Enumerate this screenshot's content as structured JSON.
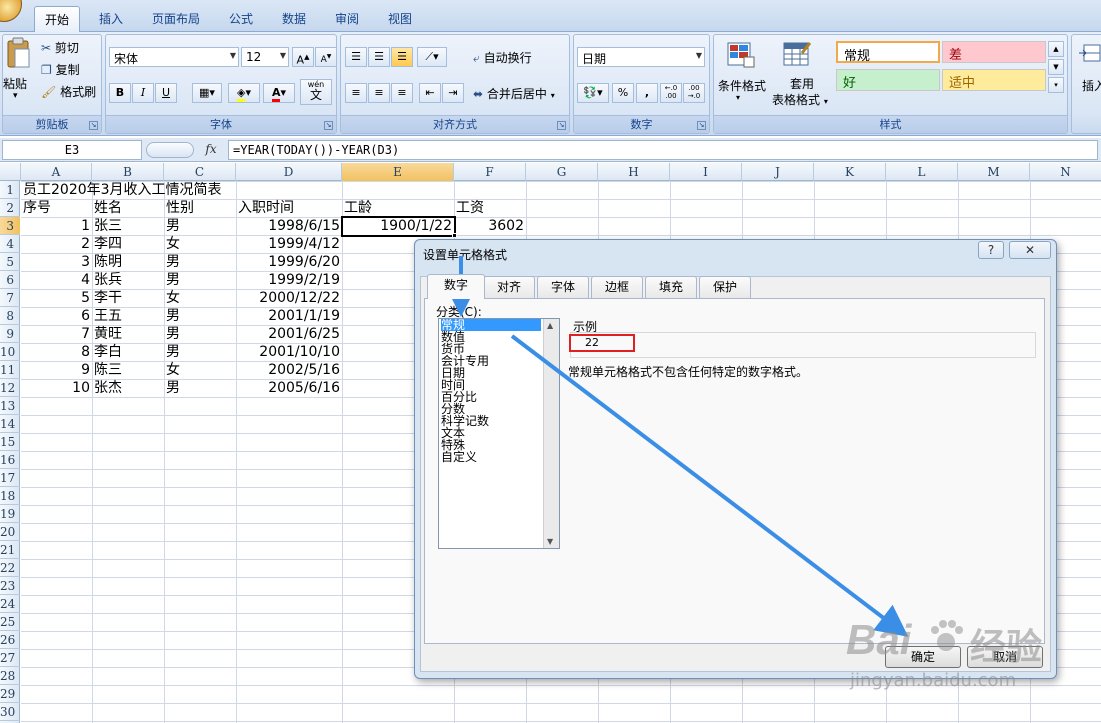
{
  "ribbon": {
    "tabs": [
      "开始",
      "插入",
      "页面布局",
      "公式",
      "数据",
      "审阅",
      "视图"
    ],
    "clipboard": {
      "paste": "粘贴",
      "cut": "剪切",
      "copy": "复制",
      "format_painter": "格式刷",
      "label": "剪贴板"
    },
    "font": {
      "name": "宋体",
      "size": "12",
      "bold": "B",
      "italic": "I",
      "underline": "U",
      "grow": "A",
      "shrink": "A",
      "wen": "wén",
      "wen_char": "文",
      "font_color_letter": "A",
      "label": "字体"
    },
    "alignment": {
      "wrap": "自动换行",
      "merge": "合并后居中",
      "label": "对齐方式"
    },
    "number": {
      "format": "日期",
      "percent": "%",
      "comma": ",",
      "inc_decimal": "←.0 .00",
      "dec_decimal": ".00 →.0",
      "label": "数字"
    },
    "styles": {
      "conditional": "条件格式",
      "table_format_line1": "套用",
      "table_format_line2": "表格格式",
      "normal": "常规",
      "bad": "差",
      "good": "好",
      "neutral": "适中",
      "label": "样式"
    },
    "insert": "插入",
    "colors": {
      "normal_border": "#f2a94a",
      "bad_bg": "#ffc7ce",
      "bad_fg": "#9c0006",
      "good_bg": "#c6efce",
      "good_fg": "#006100",
      "neutral_bg": "#ffeb9c",
      "neutral_fg": "#9c6500"
    }
  },
  "formula_bar": {
    "name_box": "E3",
    "fx": "fx",
    "formula": "=YEAR(TODAY())-YEAR(D3)"
  },
  "grid": {
    "columns": [
      "A",
      "B",
      "C",
      "D",
      "E",
      "F",
      "G",
      "H",
      "I",
      "J",
      "K",
      "L",
      "M",
      "N"
    ],
    "rows": [
      "1",
      "2",
      "3",
      "4",
      "5",
      "6",
      "7",
      "8",
      "9",
      "10",
      "11",
      "12",
      "13",
      "14",
      "15",
      "16",
      "17",
      "18",
      "19",
      "20",
      "21",
      "22",
      "23",
      "24",
      "25",
      "26",
      "27",
      "28",
      "29",
      "30"
    ],
    "title": "员工2020年3月收入工情况简表",
    "headers": {
      "seq": "序号",
      "name": "姓名",
      "gender": "性别",
      "hire_date": "入职时间",
      "tenure": "工龄",
      "salary": "工资"
    },
    "records": [
      {
        "seq": "1",
        "name": "张三",
        "gender": "男",
        "hire_date": "1998/6/15",
        "tenure": "1900/1/22",
        "salary": "3602"
      },
      {
        "seq": "2",
        "name": "李四",
        "gender": "女",
        "hire_date": "1999/4/12"
      },
      {
        "seq": "3",
        "name": "陈明",
        "gender": "男",
        "hire_date": "1999/6/20"
      },
      {
        "seq": "4",
        "name": "张兵",
        "gender": "男",
        "hire_date": "1999/2/19"
      },
      {
        "seq": "5",
        "name": "李干",
        "gender": "女",
        "hire_date": "2000/12/22"
      },
      {
        "seq": "6",
        "name": "王五",
        "gender": "男",
        "hire_date": "2001/1/19"
      },
      {
        "seq": "7",
        "name": "黄旺",
        "gender": "男",
        "hire_date": "2001/6/25"
      },
      {
        "seq": "8",
        "name": "李白",
        "gender": "男",
        "hire_date": "2001/10/10"
      },
      {
        "seq": "9",
        "name": "陈三",
        "gender": "女",
        "hire_date": "2002/5/16"
      },
      {
        "seq": "10",
        "name": "张杰",
        "gender": "男",
        "hire_date": "2005/6/16"
      }
    ]
  },
  "dialog": {
    "title": "设置单元格格式",
    "help": "?",
    "close": "✕",
    "tabs": [
      "数字",
      "对齐",
      "字体",
      "边框",
      "填充",
      "保护"
    ],
    "category_label": "分类(C):",
    "categories": [
      "常规",
      "数值",
      "货币",
      "会计专用",
      "日期",
      "时间",
      "百分比",
      "分数",
      "科学记数",
      "文本",
      "特殊",
      "自定义"
    ],
    "selected_category": "常规",
    "sample_label": "示例",
    "sample_value": "22",
    "description": "常规单元格格式不包含任何特定的数字格式。",
    "ok": "确定",
    "cancel": "取消",
    "annotation_color": "#3a8ee6",
    "highlight_color": "#e02020"
  },
  "watermark": {
    "brand_left": "Bai",
    "brand_right": "经验",
    "url": "jingyan.baidu.com"
  }
}
